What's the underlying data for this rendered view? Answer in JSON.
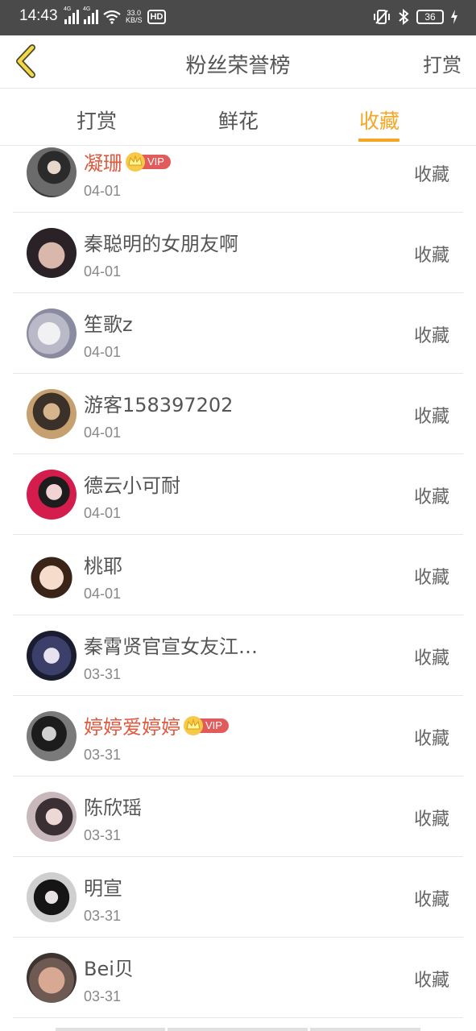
{
  "status_bar": {
    "time": "14:43",
    "signal1_tag": "4G",
    "signal2_tag": "4G",
    "net_speed_value": "33.0",
    "net_speed_unit": "KB/S",
    "hd_label": "HD",
    "battery_level": "36"
  },
  "header": {
    "title": "粉丝荣誉榜",
    "action_label": "打赏"
  },
  "tabs": [
    {
      "label": "打赏",
      "active": false
    },
    {
      "label": "鲜花",
      "active": false
    },
    {
      "label": "收藏",
      "active": true
    }
  ],
  "colors": {
    "accent": "#f5a623",
    "vip_name": "#e2583e",
    "vip_badge": "#e25b5b",
    "status_bar": "#4a4a4a"
  },
  "vip_label": "VIP",
  "fans": [
    {
      "name": "凝珊",
      "date": "04-01",
      "action": "收藏",
      "vip": true
    },
    {
      "name": "秦聪明的女朋友啊",
      "date": "04-01",
      "action": "收藏",
      "vip": false
    },
    {
      "name": "笙歌z",
      "date": "04-01",
      "action": "收藏",
      "vip": false
    },
    {
      "name": "游客158397202",
      "date": "04-01",
      "action": "收藏",
      "vip": false
    },
    {
      "name": "德云小可耐",
      "date": "04-01",
      "action": "收藏",
      "vip": false
    },
    {
      "name": "桃耶",
      "date": "04-01",
      "action": "收藏",
      "vip": false
    },
    {
      "name": "秦霄贤官宣女友江…",
      "date": "03-31",
      "action": "收藏",
      "vip": false
    },
    {
      "name": "婷婷爱婷婷",
      "date": "03-31",
      "action": "收藏",
      "vip": true
    },
    {
      "name": "陈欣瑶",
      "date": "03-31",
      "action": "收藏",
      "vip": false
    },
    {
      "name": "明宣",
      "date": "03-31",
      "action": "收藏",
      "vip": false
    },
    {
      "name": "Bei贝",
      "date": "03-31",
      "action": "收藏",
      "vip": false
    }
  ]
}
